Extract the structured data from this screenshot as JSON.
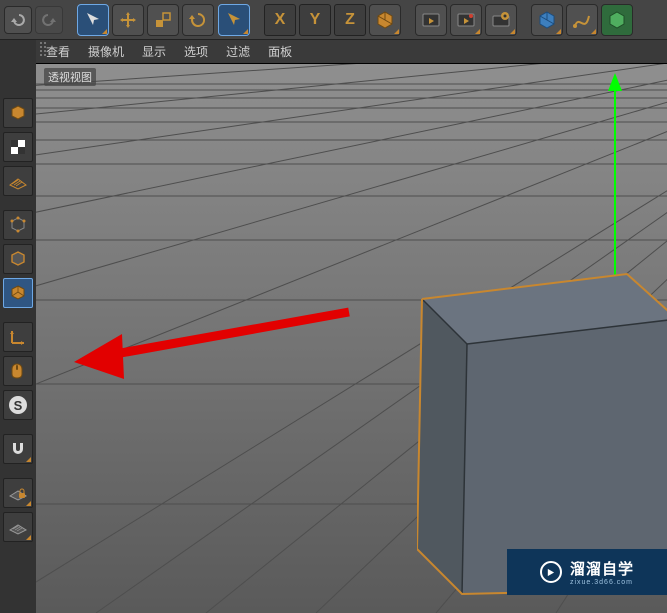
{
  "toolbar": {
    "undo": "undo",
    "redo": "redo",
    "select": "select",
    "move": "move",
    "scale": "scale",
    "rotate": "rotate",
    "lasso": "lasso",
    "x": "X",
    "y": "Y",
    "z": "Z",
    "cube": "cube",
    "render": "render",
    "render_region": "render-region",
    "render_settings": "render-settings",
    "material_cube": "material-cube",
    "pen": "pen",
    "sphere": "sphere"
  },
  "menu": {
    "view": "查看",
    "camera": "摄像机",
    "display": "显示",
    "options": "选项",
    "filter": "过滤",
    "panel": "面板"
  },
  "side": {
    "make_editable": "make-editable",
    "cube_obj": "object-cube",
    "checker": "checker",
    "mesh": "mesh-grid",
    "cube_pts": "points-mode",
    "cube_edge": "edges-mode",
    "cube_face": "polygons-mode",
    "axis": "axis-mode",
    "tweak": "tweak-mode",
    "soft": "S",
    "magnet": "magnet",
    "workplane1": "workplane-locked",
    "workplane2": "workplane"
  },
  "viewport": {
    "label": "透视视图"
  },
  "watermark": {
    "name": "溜溜自学",
    "url": "zixue.3d66.com"
  }
}
